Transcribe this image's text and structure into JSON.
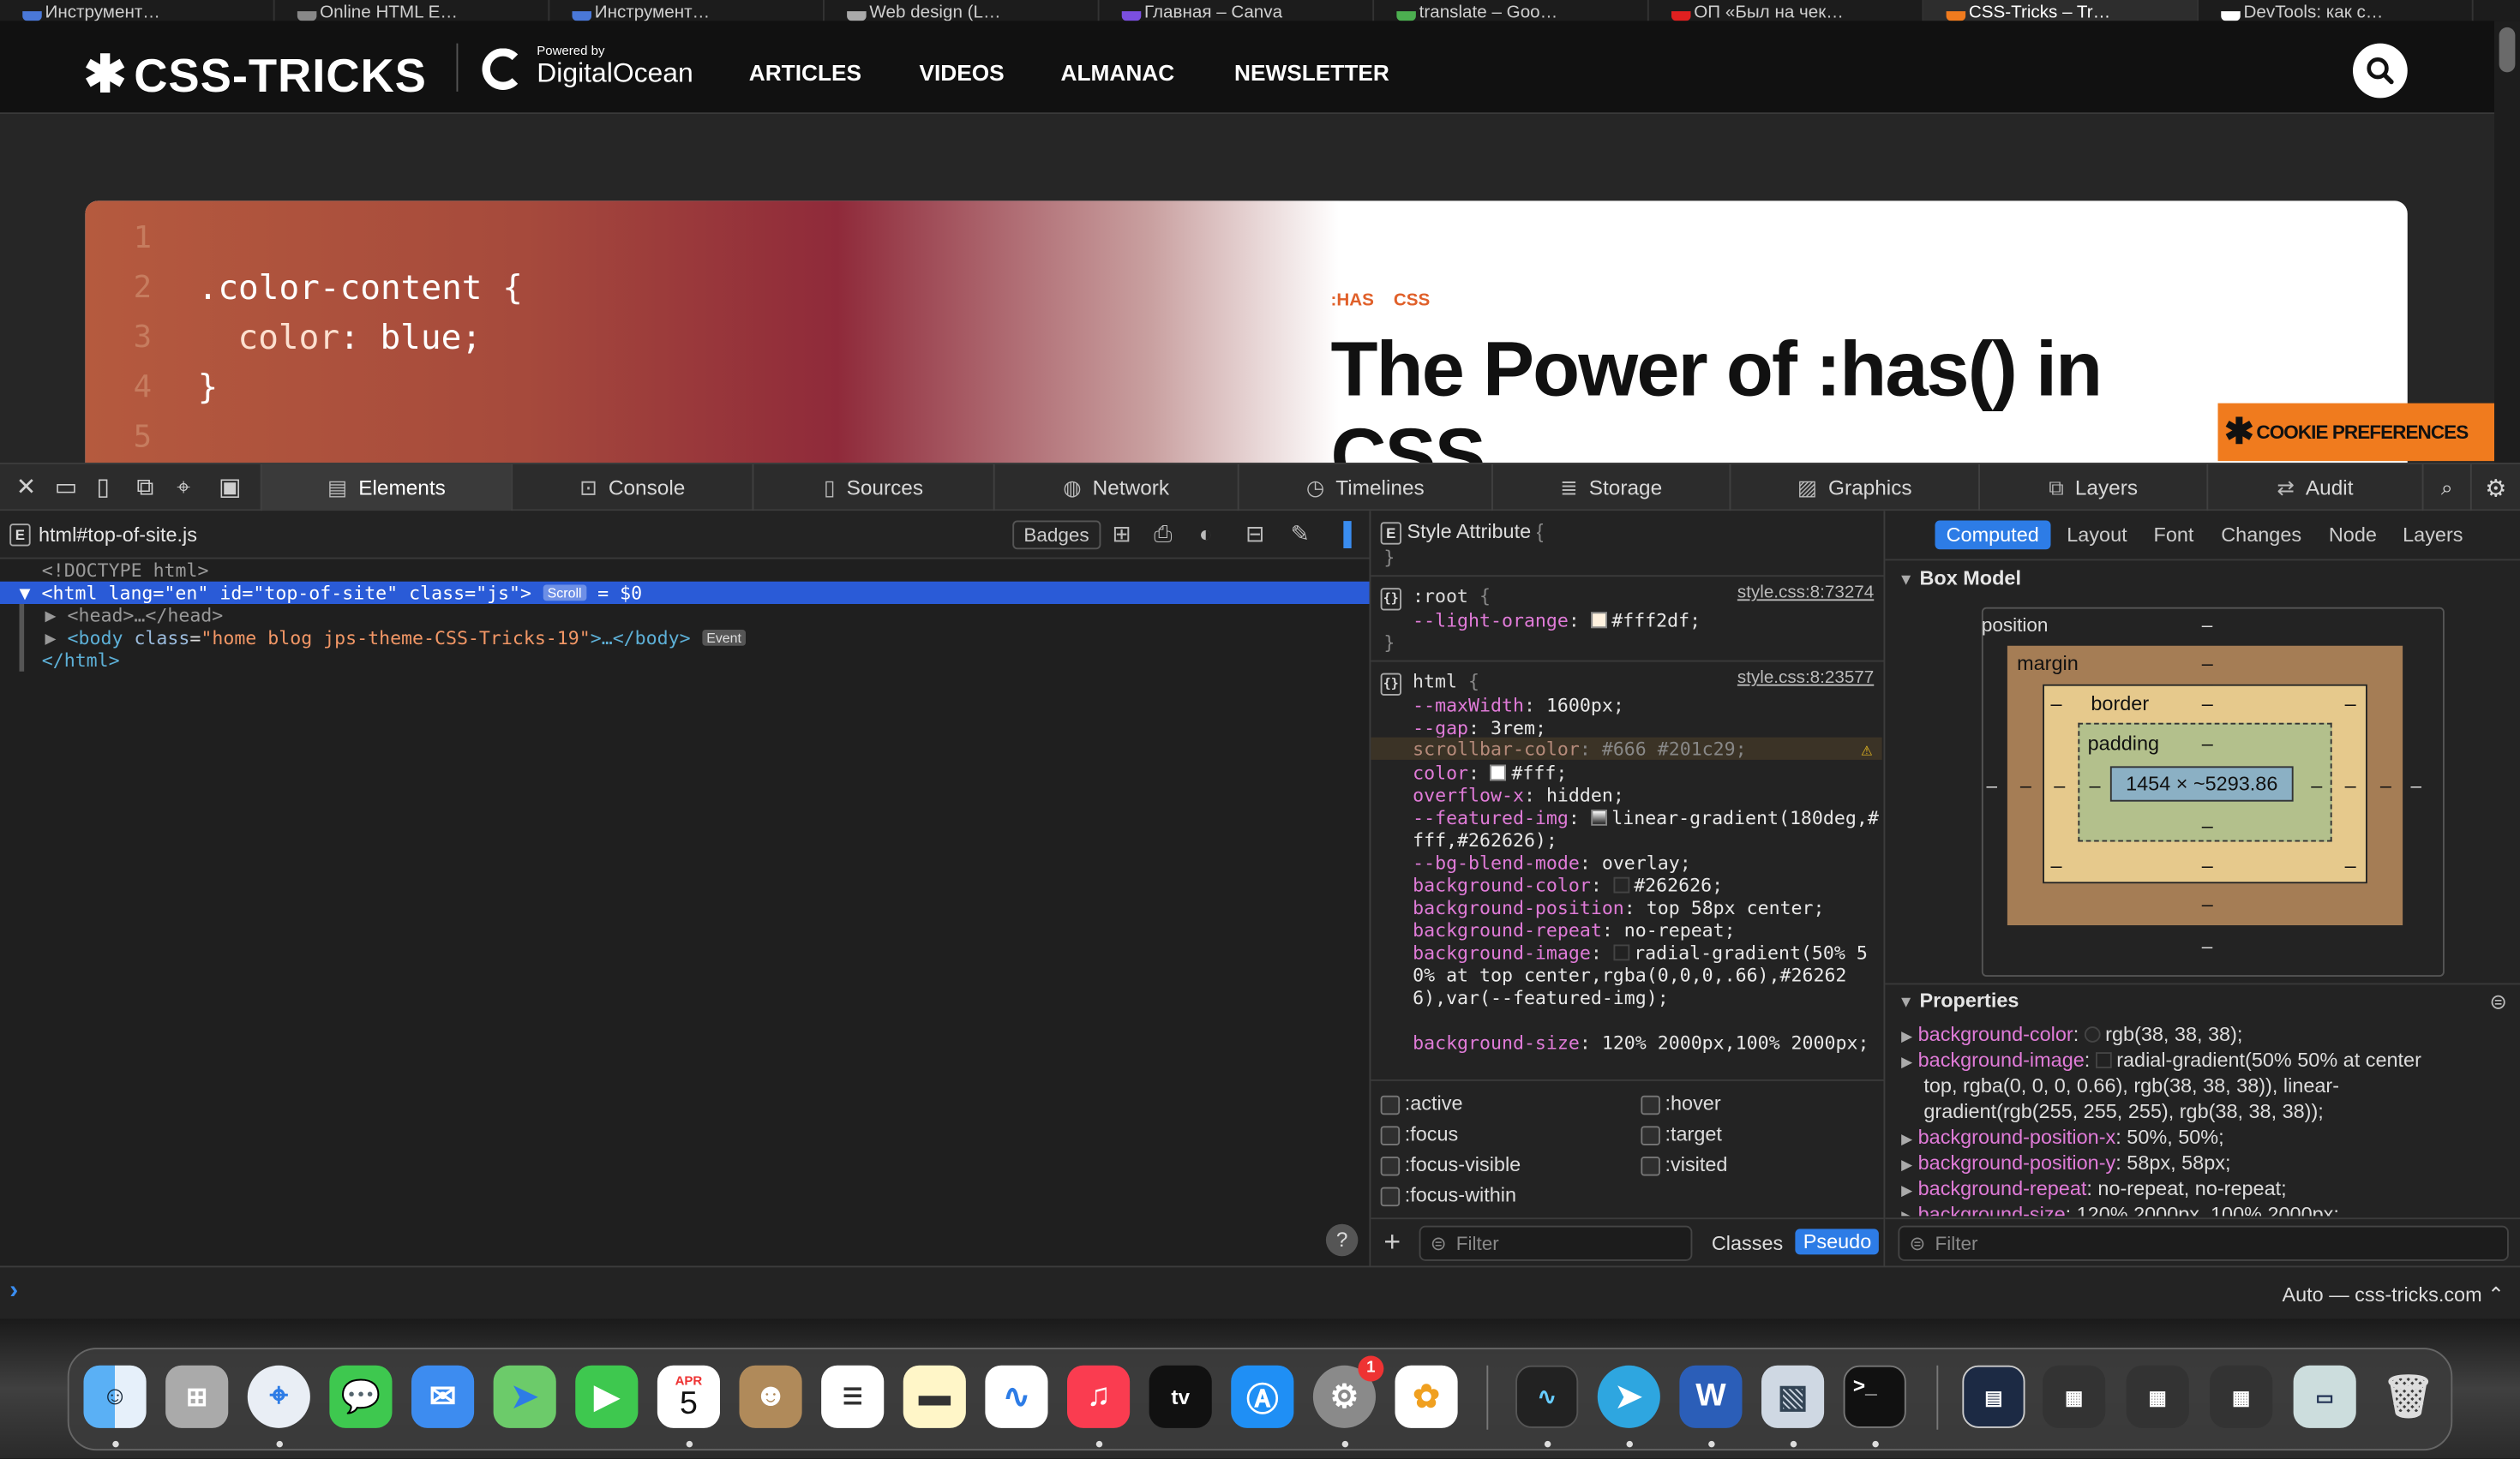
{
  "browser_tabs": [
    {
      "label": "Инструмент…"
    },
    {
      "label": "Online HTML E…"
    },
    {
      "label": "Инструмент…"
    },
    {
      "label": "Web design (L…"
    },
    {
      "label": "Главная – Canva"
    },
    {
      "label": "translate – Goo…"
    },
    {
      "label": "ОП «Был на чек…"
    },
    {
      "label": "CSS-Tricks – Tr…",
      "active": true
    },
    {
      "label": "DevTools: как с…"
    }
  ],
  "site": {
    "logo": "CSS-TRICKS",
    "powered_by": "Powered by",
    "sponsor": "DigitalOcean",
    "nav": [
      "ARTICLES",
      "VIDEOS",
      "ALMANAC",
      "NEWSLETTER"
    ],
    "hero": {
      "line_numbers": [
        "1",
        "2",
        "3",
        "4",
        "5"
      ],
      "code_line1": ".color-content {",
      "code_line2_prop": "color",
      "code_line2_val": "blue;",
      "code_line3": "}",
      "tag1": ":HAS",
      "tag2": "CSS",
      "title_line1": "The Power of :has() in",
      "title_line2": "CSS"
    },
    "cookie_button": "COOKIE PREFERENCES"
  },
  "devtools": {
    "tabs": [
      "Elements",
      "Console",
      "Sources",
      "Network",
      "Timelines",
      "Storage",
      "Graphics",
      "Layers",
      "Audit"
    ],
    "selected_tab": "Elements",
    "breadcrumb": "html#top-of-site.js",
    "badges_button": "Badges",
    "dom": {
      "doctype": "<!DOCTYPE html>",
      "html_tag": "html",
      "html_attrs": [
        {
          "name": "lang",
          "value": "\"en\""
        },
        {
          "name": "id",
          "value": "\"top-of-site\""
        },
        {
          "name": "class",
          "value": "\"js\""
        }
      ],
      "scroll_badge": "Scroll",
      "html_var": "= $0",
      "head": "<head>…</head>",
      "body_attr_name": "class",
      "body_attr_value": "\"home blog jps-theme-CSS-Tricks-19\"",
      "body_close": ">…</body>",
      "event_badge": "Event",
      "html_close": "</html>"
    },
    "styles": {
      "style_attribute": "Style Attribute",
      "root_selector": ":root",
      "root_source": "style.css:8:73274",
      "root_props": [
        {
          "name": "--light-orange",
          "value": "#fff2df"
        }
      ],
      "html_selector": "html",
      "html_source": "style.css:8:23577",
      "html_props": [
        {
          "name": "--maxWidth",
          "value": "1600px"
        },
        {
          "name": "--gap",
          "value": "3rem"
        },
        {
          "name": "scrollbar-color",
          "value": "#666 #201c29",
          "warning": true
        },
        {
          "name": "color",
          "value": "#fff"
        },
        {
          "name": "overflow-x",
          "value": "hidden"
        },
        {
          "name": "--featured-img",
          "value": "linear-gradient(180deg,#fff,#262626)"
        },
        {
          "name": "--bg-blend-mode",
          "value": "overlay"
        },
        {
          "name": "background-color",
          "value": "#262626"
        },
        {
          "name": "background-position",
          "value": "top 58px center"
        },
        {
          "name": "background-repeat",
          "value": "no-repeat"
        },
        {
          "name": "background-image",
          "value": "radial-gradient(50% 50% at top center,rgba(0,0,0,.66),#262626),var(--featured-img)"
        },
        {
          "name": "background-size",
          "value": "120% 2000px,100% 2000px"
        }
      ],
      "pseudo_states": [
        ":active",
        ":hover",
        ":focus",
        ":target",
        ":focus-visible",
        ":visited",
        ":focus-within"
      ],
      "filter_placeholder": "Filter",
      "classes_button": "Classes",
      "pseudo_button": "Pseudo"
    },
    "computed": {
      "tabs": [
        "Computed",
        "Layout",
        "Font",
        "Changes",
        "Node",
        "Layers"
      ],
      "box_model_title": "Box Model",
      "box_model": {
        "position_label": "position",
        "margin_label": "margin",
        "border_label": "border",
        "padding_label": "padding",
        "content_size": "1454 × ~5293.86",
        "dash": "–"
      },
      "properties_title": "Properties",
      "properties": [
        {
          "name": "background-color",
          "value": "rgb(38, 38, 38);"
        },
        {
          "name": "background-image",
          "value": "radial-gradient(50% 50% at center"
        },
        {
          "name": "",
          "value": "top, rgba(0, 0, 0, 0.66), rgb(38, 38, 38)),  linear-"
        },
        {
          "name": "",
          "value": "gradient(rgb(255, 255, 255), rgb(38, 38, 38));"
        },
        {
          "name": "background-position-x",
          "value": "50%, 50%;"
        },
        {
          "name": "background-position-y",
          "value": "58px, 58px;"
        },
        {
          "name": "background-repeat",
          "value": "no-repeat, no-repeat;"
        },
        {
          "name": "background-size",
          "value": "120% 2000px, 100% 2000px;"
        }
      ],
      "filter_placeholder": "Filter"
    },
    "console": {
      "prompt": "›",
      "context": "Auto — css-tricks.com"
    }
  },
  "dock": {
    "apps": [
      "Finder",
      "Launchpad",
      "Safari",
      "Messages",
      "Mail",
      "Maps",
      "FaceTime",
      "Calendar",
      "Contacts",
      "Reminders",
      "Notes",
      "Freeform",
      "Music",
      "TV",
      "App Store",
      "System Settings",
      "Photos",
      "Activity Monitor",
      "Telegram",
      "Word",
      "Preview",
      "Terminal"
    ],
    "calendar_month": "APR",
    "calendar_day": "5",
    "settings_badge": "1",
    "tv_label": "tv"
  },
  "colors": {
    "accent": "#2d7ce6",
    "selection": "#2a5bd7",
    "cookie": "#f07b1e",
    "tag_orange": "#e0602a"
  }
}
